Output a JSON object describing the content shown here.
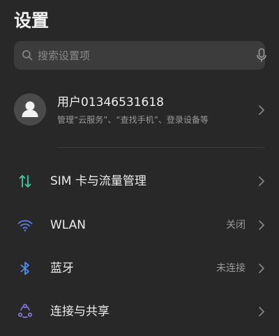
{
  "header": {
    "title": "设置"
  },
  "search": {
    "placeholder": "搜索设置项",
    "value": ""
  },
  "account": {
    "name": "用户01346531618",
    "subtitle": "管理“云服务”、“查找手机”、登录设备等"
  },
  "settings": [
    {
      "label": "SIM 卡与流量管理",
      "value": "",
      "icon": "sim-data-icon"
    },
    {
      "label": "WLAN",
      "value": "关闭",
      "icon": "wifi-icon"
    },
    {
      "label": "蓝牙",
      "value": "未连接",
      "icon": "bluetooth-icon"
    },
    {
      "label": "连接与共享",
      "value": "",
      "icon": "connection-share-icon"
    }
  ],
  "colors": {
    "background": "#282828",
    "search_background": "#3c3c3c",
    "sim_icon": "#3ecba0",
    "wifi_icon": "#5b7cf0",
    "bluetooth_icon": "#4a90f0",
    "share_icon": "#8b7ee8"
  }
}
